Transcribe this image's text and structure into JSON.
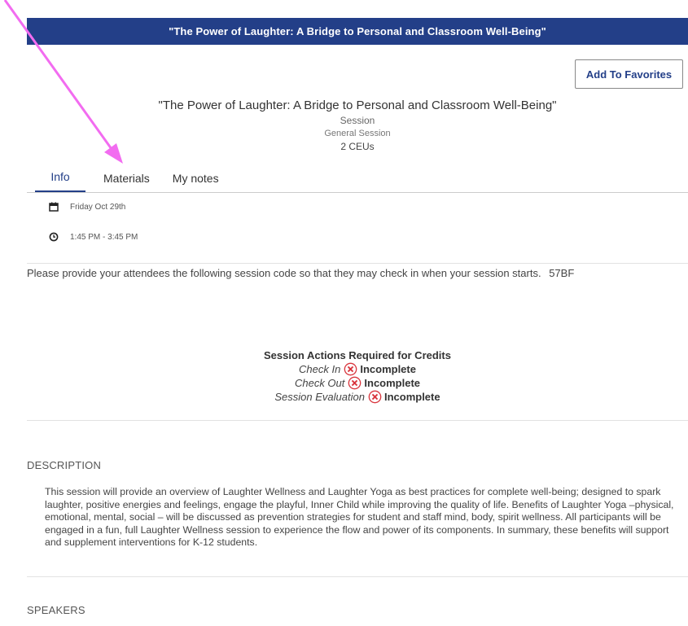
{
  "header": {
    "title": "\"The Power of Laughter: A Bridge to Personal and Classroom Well-Being\""
  },
  "actions": {
    "favorites_label": "Add To Favorites"
  },
  "session": {
    "title": "\"The Power of Laughter: A Bridge to Personal and Classroom Well-Being\"",
    "type": "Session",
    "category": "General Session",
    "ceus": "2 CEUs"
  },
  "tabs": [
    {
      "label": "Info"
    },
    {
      "label": "Materials"
    },
    {
      "label": "My notes"
    }
  ],
  "schedule": {
    "date": "Friday Oct 29th",
    "time": "1:45 PM - 3:45 PM"
  },
  "checkin": {
    "message": "Please provide your attendees the following session code so that they may check in when your session starts.",
    "code": "57BF"
  },
  "credits": {
    "heading": "Session Actions Required for Credits",
    "items": [
      {
        "label": "Check In",
        "status": "Incomplete"
      },
      {
        "label": "Check Out",
        "status": "Incomplete"
      },
      {
        "label": "Session Evaluation",
        "status": "Incomplete"
      }
    ]
  },
  "description": {
    "label": "DESCRIPTION",
    "text": "This session will provide an overview of Laughter Wellness and Laughter Yoga  as best practices for complete well-being; designed to spark laughter, positive energies and feelings, engage the playful, Inner Child while improving the quality of life. Benefits of Laughter Yoga –physical, emotional, mental, social – will be discussed as prevention strategies for student and staff mind, body, spirit wellness.  All participants will be engaged in a fun, full Laughter Wellness session to experience the flow and power of its components.  In summary, these benefits will support and supplement interventions for K-12 students."
  },
  "speakers": {
    "label": "SPEAKERS"
  },
  "colors": {
    "brand": "#233f88",
    "incomplete": "#d9363e",
    "annotation_arrow": "#f26cf0"
  },
  "icons": {
    "date": "calendar-icon",
    "time": "clock-icon",
    "status": "x-circle-icon"
  }
}
